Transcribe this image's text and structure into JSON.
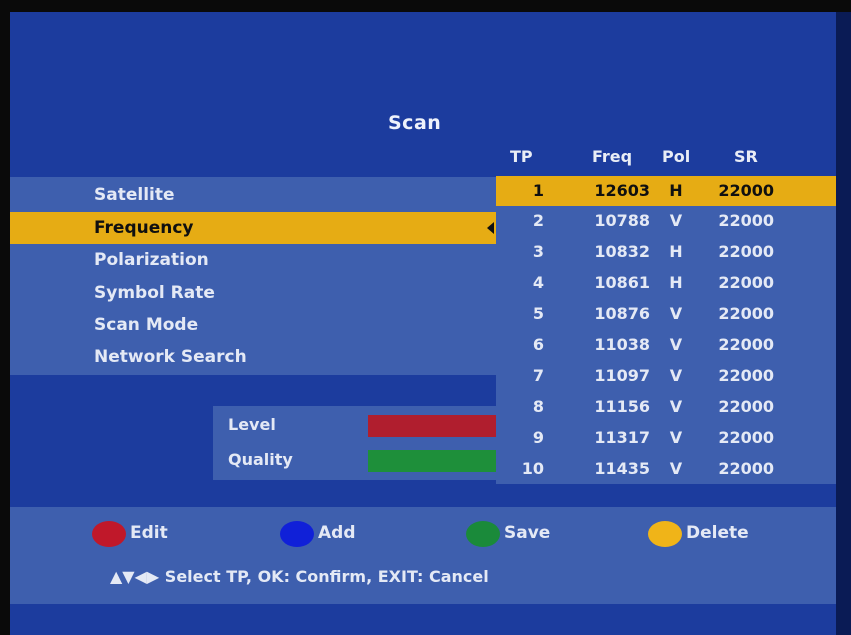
{
  "title": "Scan",
  "menu": {
    "items": [
      {
        "label": "Satellite",
        "selected": false
      },
      {
        "label": "Frequency",
        "selected": true
      },
      {
        "label": "Polarization",
        "selected": false
      },
      {
        "label": "Symbol Rate",
        "selected": false
      },
      {
        "label": "Scan Mode",
        "selected": false
      },
      {
        "label": "Network Search",
        "selected": false
      }
    ]
  },
  "signal": {
    "level_label": "Level",
    "quality_label": "Quality",
    "level_color": "#b01e2e",
    "quality_color": "#1e8f3a"
  },
  "tp_table": {
    "headers": {
      "tp": "TP",
      "freq": "Freq",
      "pol": "Pol",
      "sr": "SR"
    },
    "rows": [
      {
        "tp": "1",
        "freq": "12603",
        "pol": "H",
        "sr": "22000",
        "selected": true
      },
      {
        "tp": "2",
        "freq": "10788",
        "pol": "V",
        "sr": "22000"
      },
      {
        "tp": "3",
        "freq": "10832",
        "pol": "H",
        "sr": "22000"
      },
      {
        "tp": "4",
        "freq": "10861",
        "pol": "H",
        "sr": "22000"
      },
      {
        "tp": "5",
        "freq": "10876",
        "pol": "V",
        "sr": "22000"
      },
      {
        "tp": "6",
        "freq": "11038",
        "pol": "V",
        "sr": "22000"
      },
      {
        "tp": "7",
        "freq": "11097",
        "pol": "V",
        "sr": "22000"
      },
      {
        "tp": "8",
        "freq": "11156",
        "pol": "V",
        "sr": "22000"
      },
      {
        "tp": "9",
        "freq": "11317",
        "pol": "V",
        "sr": "22000"
      },
      {
        "tp": "10",
        "freq": "11435",
        "pol": "V",
        "sr": "22000"
      }
    ]
  },
  "keys": [
    {
      "label": "Edit",
      "color": "#c0182a",
      "icon": "red-button-icon"
    },
    {
      "label": "Add",
      "color": "#1020d8",
      "icon": "blue-button-icon"
    },
    {
      "label": "Save",
      "color": "#1a8a3a",
      "icon": "green-button-icon"
    },
    {
      "label": "Delete",
      "color": "#f0b418",
      "icon": "yellow-button-icon"
    }
  ],
  "hint": {
    "arrows": "▲▼◀▶",
    "text": "Select TP, OK: Confirm, EXIT: Cancel"
  },
  "colors": {
    "background": "#1c3c9e",
    "panel": "#3e5fae",
    "highlight": "#e6ac14"
  }
}
